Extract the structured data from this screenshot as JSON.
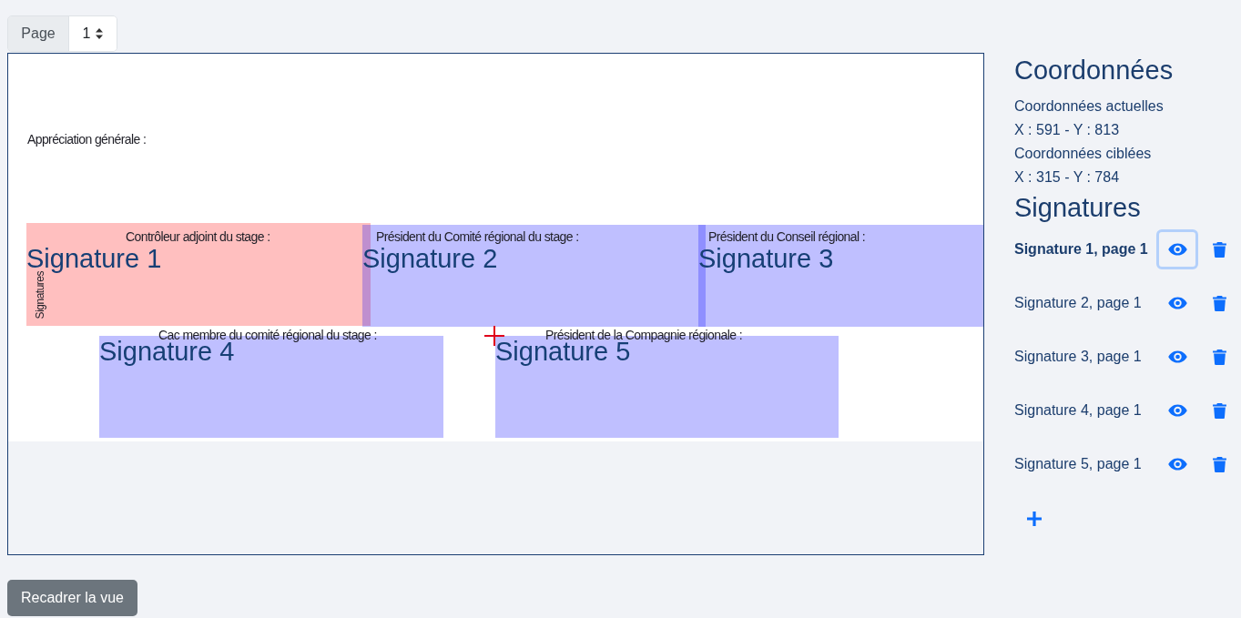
{
  "page_selector": {
    "label": "Page",
    "value": "1"
  },
  "document": {
    "texts": [
      {
        "kind": "horizontal",
        "text": "Appréciation générale :"
      },
      {
        "kind": "horizontal",
        "text": "Contrôleur adjoint du stage :"
      },
      {
        "kind": "horizontal",
        "text": "Président du Comité régional du stage :"
      },
      {
        "kind": "horizontal",
        "text": "Président du Conseil régional :"
      },
      {
        "kind": "vertical",
        "text": "Signatures"
      },
      {
        "kind": "horizontal",
        "text": "Cac membre du comité régional du stage :"
      },
      {
        "kind": "horizontal",
        "text": "Président de la Compagnie régionale :"
      }
    ]
  },
  "signatures": [
    {
      "label": "Signature 1",
      "list_label": "Signature 1, page 1",
      "selected": true
    },
    {
      "label": "Signature 2",
      "list_label": "Signature 2, page 1",
      "selected": false
    },
    {
      "label": "Signature 3",
      "list_label": "Signature 3, page 1",
      "selected": false
    },
    {
      "label": "Signature 4",
      "list_label": "Signature 4, page 1",
      "selected": false
    },
    {
      "label": "Signature 5",
      "list_label": "Signature 5, page 1",
      "selected": false
    }
  ],
  "coordinates": {
    "title": "Coordonnées",
    "current_label": "Coordonnées actuelles",
    "current_value": "X : 591 - Y : 813",
    "target_label": "Coordonnées ciblées",
    "target_value": "X : 315 - Y : 784"
  },
  "signatures_panel": {
    "title": "Signatures"
  },
  "recenter_button": "Recadrer la vue"
}
